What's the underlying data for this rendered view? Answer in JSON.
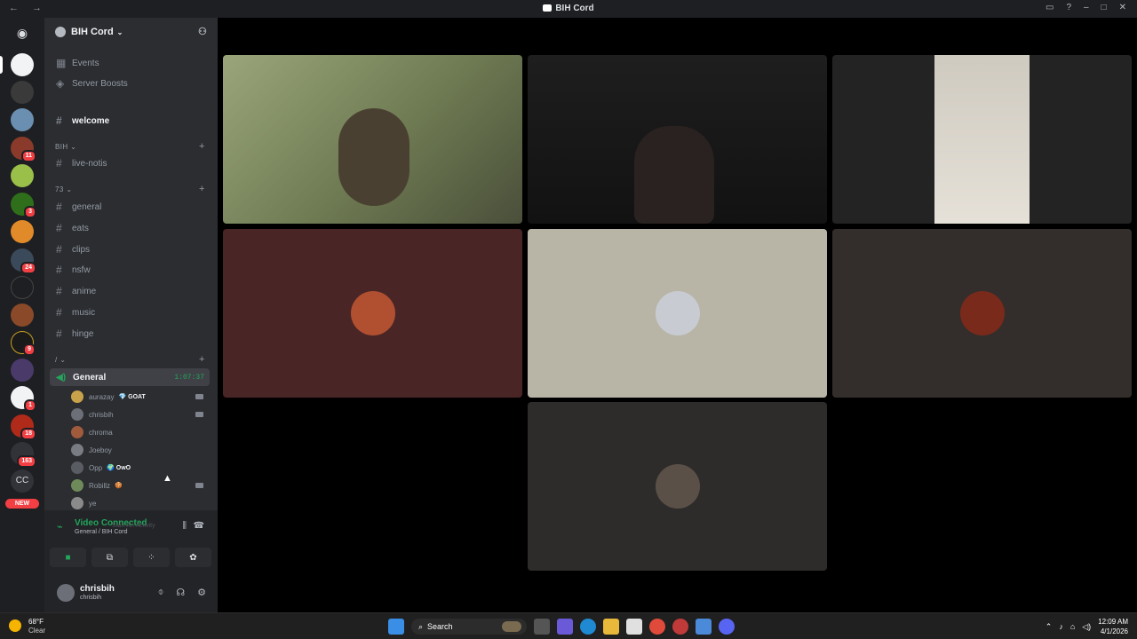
{
  "window": {
    "title": "BIH Cord",
    "nav": "← →"
  },
  "server": {
    "name": "BIH Cord",
    "menu_items": [
      {
        "label": "Events",
        "icon": "calendar-icon"
      },
      {
        "label": "Server Boosts",
        "icon": "boost-icon"
      }
    ]
  },
  "channels": {
    "welcome": "welcome",
    "cat_bih": "BIH",
    "live_notis": "live-notis",
    "cat_73": "73",
    "text": [
      "general",
      "eats",
      "clips",
      "nsfw",
      "anime",
      "music",
      "hinge"
    ],
    "cat_voice": "/"
  },
  "voice_channel": {
    "name": "General",
    "timer": "1:07:37",
    "members": [
      {
        "name": "aurazay",
        "tag": "💎 GOAT",
        "color": "#c8a24a",
        "camera": true
      },
      {
        "name": "chrisbih",
        "tag": "",
        "color": "#6d6f78",
        "camera": true
      },
      {
        "name": "chroma",
        "tag": "",
        "color": "#a05a3c",
        "camera": false
      },
      {
        "name": "Joeboy",
        "tag": "",
        "color": "#7a7c84",
        "camera": false
      },
      {
        "name": "Opp",
        "tag": "🌍 OwO",
        "color": "#5a5c64",
        "camera": false
      },
      {
        "name": "Robillz",
        "tag": "🍪",
        "color": "#6e8a5a",
        "camera": true
      },
      {
        "name": "ye",
        "tag": "",
        "color": "#8a8a8a",
        "camera": false
      }
    ]
  },
  "voice_panel": {
    "status": "Video Connected",
    "location": "General / BIH Cord",
    "activity_hint": "Start An Activity"
  },
  "user": {
    "display_name": "chrisbih",
    "username": "chrisbih"
  },
  "guild_badges": [
    "11",
    "3",
    "24",
    "9",
    "1",
    "18",
    "163"
  ],
  "guild_labels": {
    "cc": "CC",
    "new": "NEW"
  },
  "colors": {
    "tile_maroon": "#4a2526",
    "tile_beige": "#b8b4a6",
    "tile_brown": "#332d2b",
    "tile_dark": "#2e2c2a",
    "online_green": "#23a55a"
  },
  "taskbar": {
    "search_label": "Search",
    "weather_temp": "68°F",
    "weather_cond": "Clear",
    "time": "12:09 AM",
    "date": "4/1/2026"
  }
}
